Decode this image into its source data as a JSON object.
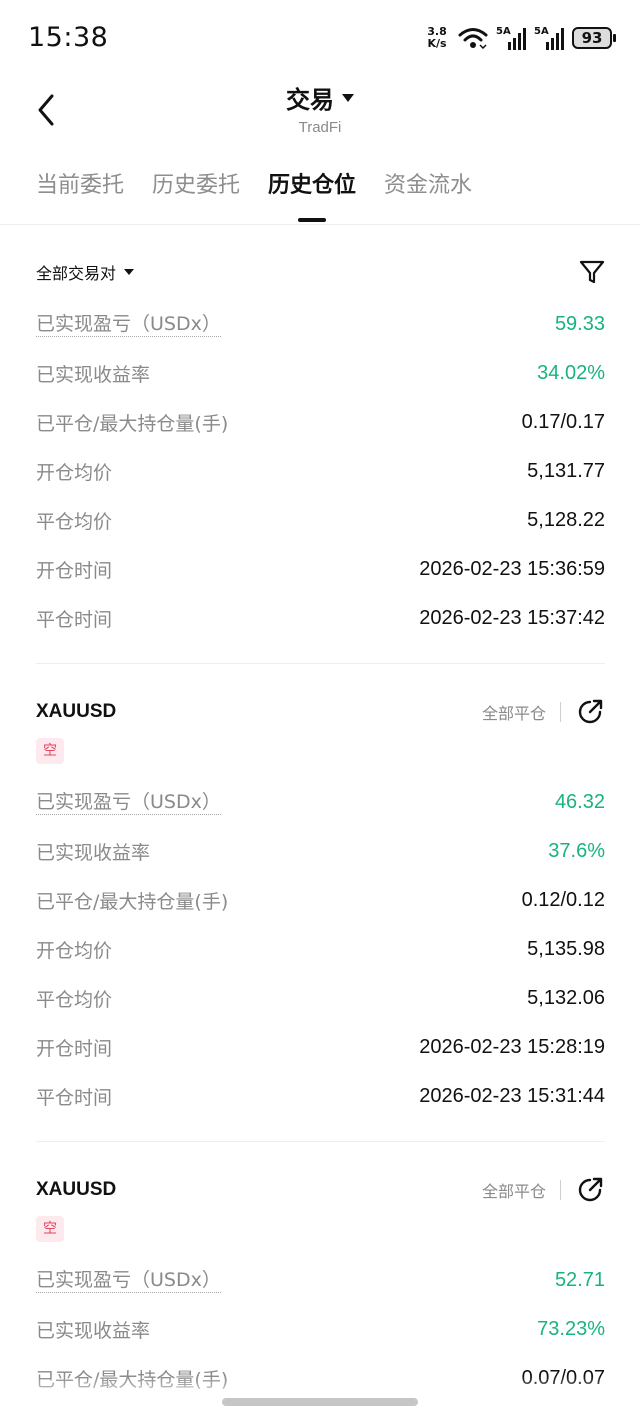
{
  "status": {
    "time": "15:38",
    "net_speed_top": "3.8",
    "net_speed_bottom": "K/s",
    "sim1": "5A",
    "sim2": "5A",
    "battery": "93"
  },
  "header": {
    "title": "交易",
    "subtitle": "TradFi"
  },
  "tabs": [
    {
      "label": "当前委托",
      "active": false
    },
    {
      "label": "历史委托",
      "active": false
    },
    {
      "label": "历史仓位",
      "active": true
    },
    {
      "label": "资金流水",
      "active": false
    }
  ],
  "filter": {
    "pair_label": "全部交易对"
  },
  "labels": {
    "pnl": "已实现盈亏（USDx）",
    "roi": "已实现收益率",
    "qty": "已平仓/最大持仓量(手)",
    "open_price": "开仓均价",
    "close_price": "平仓均价",
    "open_time": "开仓时间",
    "close_time": "平仓时间",
    "close_all": "全部平仓"
  },
  "records": [
    {
      "pnl": "59.33",
      "roi": "34.02%",
      "qty": "0.17/0.17",
      "open_price": "5,131.77",
      "close_price": "5,128.22",
      "open_time": "2026-02-23 15:36:59",
      "close_time": "2026-02-23 15:37:42"
    },
    {
      "symbol": "XAUUSD",
      "side": "空",
      "pnl": "46.32",
      "roi": "37.6%",
      "qty": "0.12/0.12",
      "open_price": "5,135.98",
      "close_price": "5,132.06",
      "open_time": "2026-02-23 15:28:19",
      "close_time": "2026-02-23 15:31:44"
    },
    {
      "symbol": "XAUUSD",
      "side": "空",
      "pnl": "52.71",
      "roi": "73.23%",
      "qty": "0.07/0.07"
    }
  ],
  "colors": {
    "profit": "#19b37e",
    "short_badge_bg": "#fde9ee",
    "short_badge_text": "#e4455f"
  }
}
